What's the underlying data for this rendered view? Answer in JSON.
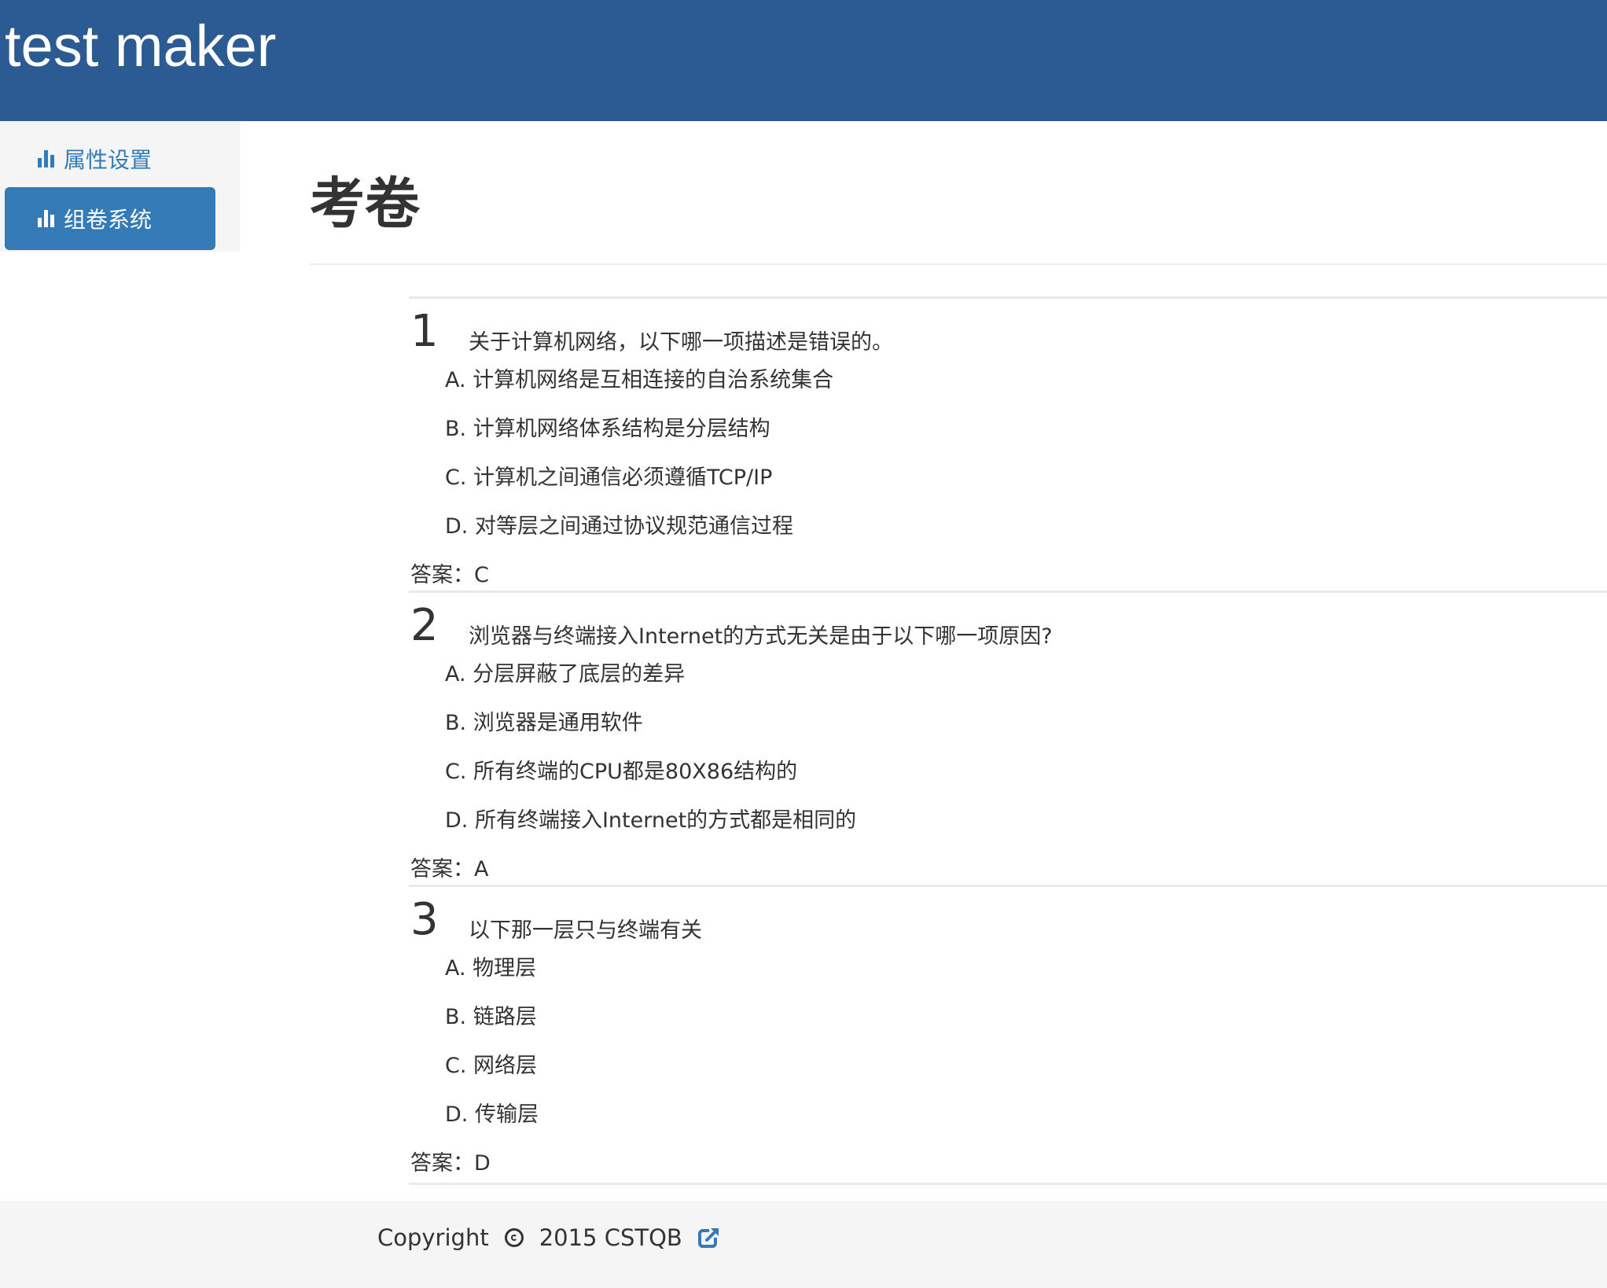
{
  "header": {
    "app_title": "test maker"
  },
  "sidebar": {
    "items": [
      {
        "label": "属性设置",
        "icon": "bar-chart-icon",
        "active": false
      },
      {
        "label": "组卷系统",
        "icon": "bar-chart-icon",
        "active": true
      }
    ]
  },
  "main": {
    "page_title": "考卷",
    "questions": [
      {
        "number": "1",
        "text": "关于计算机网络，以下哪一项描述是错误的。",
        "options": [
          "A. 计算机网络是互相连接的自治系统集合",
          "B. 计算机网络体系结构是分层结构",
          "C. 计算机之间通信必须遵循TCP/IP",
          "D. 对等层之间通过协议规范通信过程"
        ],
        "answer": "答案：C"
      },
      {
        "number": "2",
        "text": "浏览器与终端接入Internet的方式无关是由于以下哪一项原因?",
        "options": [
          "A. 分层屏蔽了底层的差异",
          "B. 浏览器是通用软件",
          "C. 所有终端的CPU都是80X86结构的",
          "D. 所有终端接入Internet的方式都是相同的"
        ],
        "answer": "答案：A"
      },
      {
        "number": "3",
        "text": "以下那一层只与终端有关",
        "options": [
          "A. 物理层",
          "B. 链路层",
          "C. 网络层",
          "D. 传输层"
        ],
        "answer": "答案：D"
      }
    ]
  },
  "footer": {
    "copyright_label": "Copyright",
    "copyright_icon": "copyright-icon",
    "org_text": "2015 CSTQB",
    "link_icon": "external-link-icon"
  },
  "colors": {
    "header_bg": "#2c5b93",
    "accent": "#337ab7",
    "footer_bg": "#f5f5f5"
  }
}
